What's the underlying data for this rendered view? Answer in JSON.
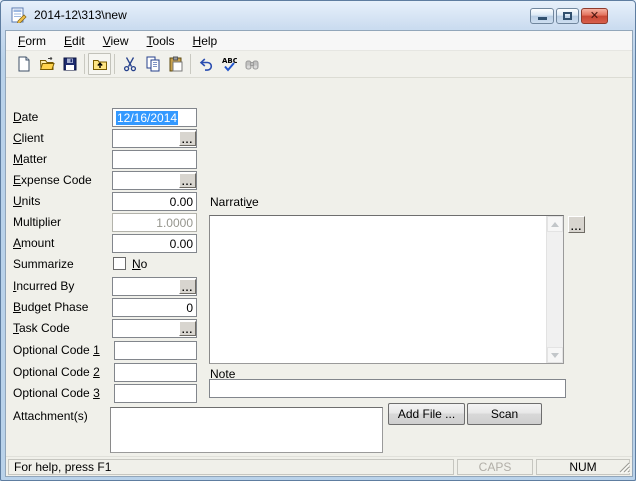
{
  "window": {
    "title": "2014-12\\313\\new",
    "icon": "form-pencil-icon"
  },
  "titlebar": {
    "buttons": [
      "minimize",
      "maximize",
      "close"
    ]
  },
  "menu": {
    "items": [
      {
        "label": {
          "pre": "",
          "key": "F",
          "post": "orm"
        }
      },
      {
        "label": {
          "pre": "",
          "key": "E",
          "post": "dit"
        }
      },
      {
        "label": {
          "pre": "",
          "key": "V",
          "post": "iew"
        }
      },
      {
        "label": {
          "pre": "",
          "key": "T",
          "post": "ools"
        }
      },
      {
        "label": {
          "pre": "",
          "key": "H",
          "post": "elp"
        }
      }
    ]
  },
  "toolbar": {
    "icons": [
      "new-document",
      "open",
      "save",
      "up-one-level",
      "cut",
      "copy",
      "paste",
      "undo",
      "spell-check",
      "find"
    ]
  },
  "form": {
    "fields": {
      "date": {
        "label": {
          "pre": "",
          "key": "D",
          "post": "ate"
        },
        "value": "12/16/2014",
        "selected": true
      },
      "client": {
        "label": {
          "pre": "",
          "key": "C",
          "post": "lient"
        },
        "value": "",
        "browse": "..."
      },
      "matter": {
        "label": {
          "pre": "",
          "key": "M",
          "post": "atter"
        },
        "value": ""
      },
      "expense_code": {
        "label": {
          "pre": "",
          "key": "E",
          "post": "xpense Code"
        },
        "value": "",
        "browse": "..."
      },
      "units": {
        "label": {
          "pre": "",
          "key": "U",
          "post": "nits"
        },
        "value": "0.00"
      },
      "multiplier": {
        "label": {
          "pre": "Multiplier",
          "key": "",
          "post": ""
        },
        "value": "1.0000",
        "disabled": true
      },
      "amount": {
        "label": {
          "pre": "",
          "key": "A",
          "post": "mount"
        },
        "value": "0.00"
      },
      "summarize": {
        "label": {
          "pre": "Summarize",
          "key": "",
          "post": ""
        },
        "checkbox_label": {
          "pre": "",
          "key": "N",
          "post": "o"
        },
        "checked": false
      },
      "incurred_by": {
        "label": {
          "pre": "",
          "key": "I",
          "post": "ncurred By"
        },
        "value": "",
        "browse": "..."
      },
      "budget_phase": {
        "label": {
          "pre": "",
          "key": "B",
          "post": "udget Phase"
        },
        "value": "0"
      },
      "task_code": {
        "label": {
          "pre": "",
          "key": "T",
          "post": "ask Code"
        },
        "value": "",
        "browse": "..."
      },
      "optional_code_1": {
        "label": {
          "pre": "Optional Code ",
          "key": "1",
          "post": ""
        },
        "value": ""
      },
      "optional_code_2": {
        "label": {
          "pre": "Optional Code ",
          "key": "2",
          "post": ""
        },
        "value": ""
      },
      "optional_code_3": {
        "label": {
          "pre": "Optional Code ",
          "key": "3",
          "post": ""
        },
        "value": ""
      },
      "attachments": {
        "label": {
          "pre": "Attachment(s)",
          "key": "",
          "post": ""
        }
      }
    },
    "narrative": {
      "label": {
        "pre": "Narrati",
        "key": "v",
        "post": "e"
      },
      "value": "",
      "browse": "..."
    },
    "note": {
      "label": {
        "pre": "N",
        "key": "o",
        "post": "te"
      },
      "value": ""
    },
    "buttons": {
      "add_file": "Add File ...",
      "scan": "Scan"
    }
  },
  "statusbar": {
    "help": "For help, press F1",
    "caps": "CAPS",
    "num": "NUM"
  },
  "colors": {
    "selection": "#3399ff",
    "frame_blue": "#b9d2ea",
    "close_red": "#c84634",
    "disabled_text": "#96968e",
    "caps_disabled": "#b1aea7"
  }
}
